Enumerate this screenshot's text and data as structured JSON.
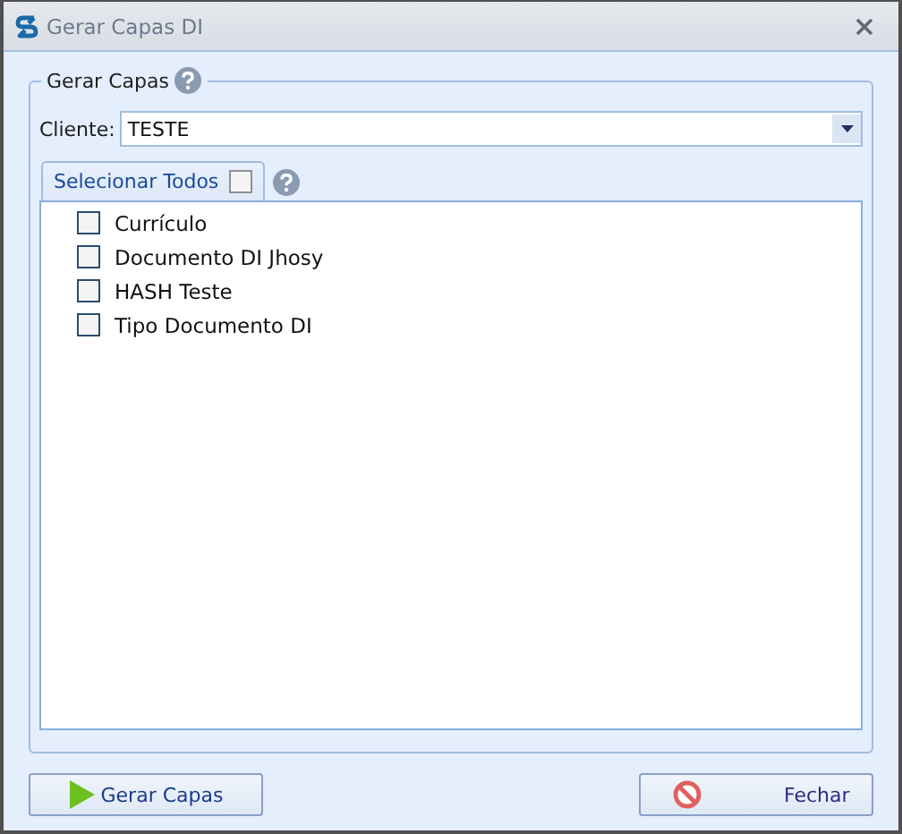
{
  "window": {
    "title": "Gerar Capas DI"
  },
  "group": {
    "title": "Gerar Capas"
  },
  "client": {
    "label": "Cliente:",
    "value": "TESTE"
  },
  "select_all": {
    "label": "Selecionar Todos",
    "checked": false
  },
  "items": [
    {
      "label": "Currículo",
      "checked": false
    },
    {
      "label": "Documento DI Jhosy",
      "checked": false
    },
    {
      "label": "HASH Teste",
      "checked": false
    },
    {
      "label": "Tipo Documento DI",
      "checked": false
    }
  ],
  "buttons": [
    {
      "label": "Gerar Capas",
      "kind": "play"
    },
    {
      "label": "Fechar",
      "kind": "cancel"
    }
  ]
}
